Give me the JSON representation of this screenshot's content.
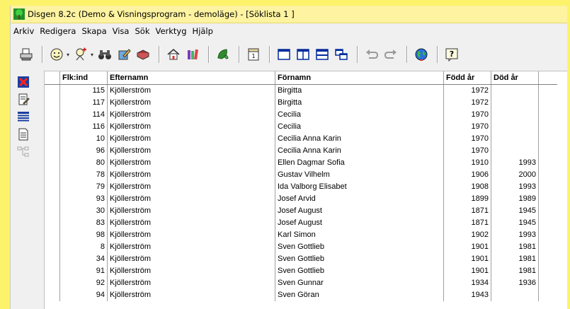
{
  "window": {
    "title": "Disgen 8.2c (Demo & Visningsprogram - demoläge) - [Söklista 1 ]"
  },
  "menu": {
    "items": [
      "Arkiv",
      "Redigera",
      "Skapa",
      "Visa",
      "Sök",
      "Verktyg",
      "Hjälp"
    ]
  },
  "toolbar": {
    "icons": [
      "print-icon",
      "person-icon",
      "add-person-icon",
      "binoculars-icon",
      "edit-note-icon",
      "book-icon",
      "home-icon",
      "books-icon",
      "green-leaf-icon",
      "calendar-icon",
      "single-pane-icon",
      "split-vertical-icon",
      "split-horizontal-icon",
      "cascade-icon",
      "undo-icon",
      "redo-icon",
      "globe-icon",
      "help-icon"
    ]
  },
  "sidebar": {
    "icons": [
      "close-list-icon",
      "edit-document-icon",
      "list-view-icon",
      "document-icon",
      "tree-view-icon"
    ]
  },
  "table": {
    "headers": [
      "Flk:ind",
      "Efternamn",
      "Förnamn",
      "Född år",
      "Död år"
    ],
    "rows": [
      {
        "id": "115",
        "surname": "Kjöllerström",
        "given": "Birgitta",
        "born": "1972",
        "died": ""
      },
      {
        "id": "117",
        "surname": "Kjöllerström",
        "given": "Birgitta",
        "born": "1972",
        "died": ""
      },
      {
        "id": "114",
        "surname": "Kjöllerström",
        "given": "Cecilia",
        "born": "1970",
        "died": ""
      },
      {
        "id": "116",
        "surname": "Kjöllerström",
        "given": "Cecilia",
        "born": "1970",
        "died": ""
      },
      {
        "id": "10",
        "surname": "Kjöllerström",
        "given": "Cecilia Anna Karin",
        "born": "1970",
        "died": ""
      },
      {
        "id": "96",
        "surname": "Kjöllerström",
        "given": "Cecilia Anna Karin",
        "born": "1970",
        "died": ""
      },
      {
        "id": "80",
        "surname": "Kjöllerström",
        "given": "Ellen Dagmar Sofia",
        "born": "1910",
        "died": "1993"
      },
      {
        "id": "78",
        "surname": "Kjöllerström",
        "given": "Gustav Vilhelm",
        "born": "1906",
        "died": "2000"
      },
      {
        "id": "79",
        "surname": "Kjöllerström",
        "given": "Ida Valborg Elisabet",
        "born": "1908",
        "died": "1993"
      },
      {
        "id": "93",
        "surname": "Kjöllerström",
        "given": "Josef Arvid",
        "born": "1899",
        "died": "1989"
      },
      {
        "id": "30",
        "surname": "Kjöllerström",
        "given": "Josef August",
        "born": "1871",
        "died": "1945"
      },
      {
        "id": "83",
        "surname": "Kjöllerström",
        "given": "Josef August",
        "born": "1871",
        "died": "1945"
      },
      {
        "id": "98",
        "surname": "Kjöllerström",
        "given": "Karl Simon",
        "born": "1902",
        "died": "1993"
      },
      {
        "id": "8",
        "surname": "Kjöllerström",
        "given": "Sven Gottlieb",
        "born": "1901",
        "died": "1981"
      },
      {
        "id": "34",
        "surname": "Kjöllerström",
        "given": "Sven Gottlieb",
        "born": "1901",
        "died": "1981"
      },
      {
        "id": "91",
        "surname": "Kjöllerström",
        "given": "Sven Gottlieb",
        "born": "1901",
        "died": "1981"
      },
      {
        "id": "92",
        "surname": "Kjöllerström",
        "given": "Sven Gunnar",
        "born": "1934",
        "died": "1936"
      },
      {
        "id": "94",
        "surname": "Kjöllerström",
        "given": "Sven Göran",
        "born": "1943",
        "died": ""
      }
    ]
  }
}
